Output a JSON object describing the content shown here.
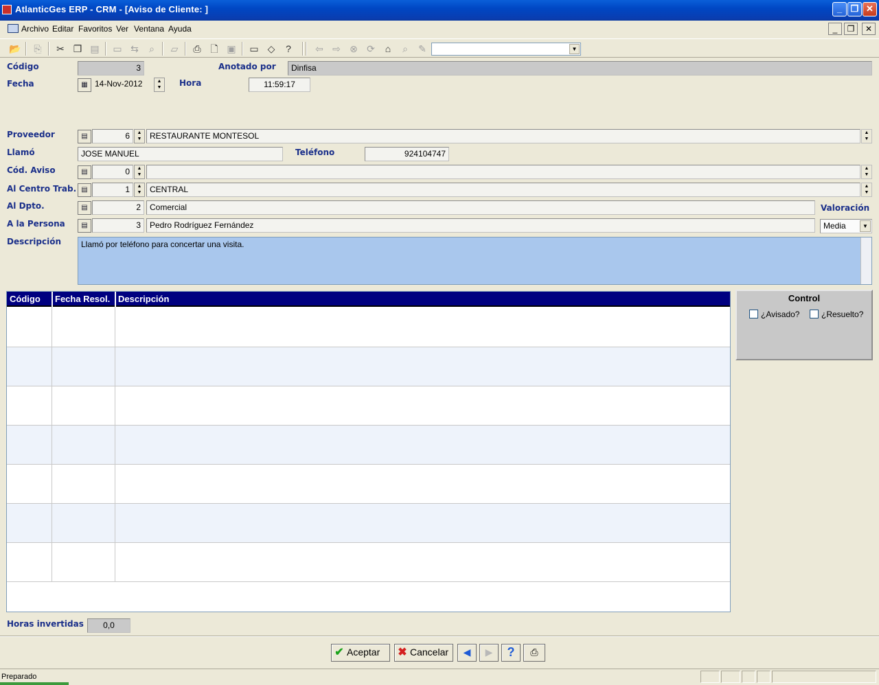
{
  "window": {
    "title": "AtlanticGes ERP - CRM - [Aviso de Cliente: ]",
    "minimize": "_",
    "restore": "❐",
    "close": "✕"
  },
  "menu": {
    "items": [
      "Archivo",
      "Editar",
      "Favoritos",
      "Ver",
      "Ventana",
      "Ayuda"
    ],
    "mdi_minimize": "_",
    "mdi_restore": "❐",
    "mdi_close": "✕"
  },
  "toolbar": {
    "combo_value": "",
    "combo_arrow": "▼",
    "icons": [
      "open-folder",
      "export",
      "cut",
      "copy",
      "paste",
      "window",
      "find-replace",
      "zoom",
      "eraser",
      "print",
      "print-preview",
      "save",
      "monitor",
      "eraser2",
      "help",
      "back",
      "forward",
      "stop",
      "refresh",
      "home",
      "search-web",
      "edit"
    ]
  },
  "form": {
    "codigo_label": "Código",
    "codigo_value": "3",
    "anotado_label": "Anotado por",
    "anotado_value": "Dinfisa",
    "fecha_label": "Fecha",
    "fecha_value": "14-Nov-2012",
    "hora_label": "Hora",
    "hora_value": "11:59:17",
    "proveedor_label": "Proveedor",
    "proveedor_code": "6",
    "proveedor_name": "RESTAURANTE MONTESOL",
    "llamo_label": "Llamó",
    "llamo_value": "JOSE MANUEL",
    "telefono_label": "Teléfono",
    "telefono_value": "924104747",
    "codaviso_label": "Cód. Aviso",
    "codaviso_code": "0",
    "codaviso_name": "",
    "centro_label": "Al Centro Trab.",
    "centro_code": "1",
    "centro_name": "CENTRAL",
    "dpto_label": "Al Dpto.",
    "dpto_code": "2",
    "dpto_name": "Comercial",
    "persona_label": "A la Persona",
    "persona_code": "3",
    "persona_name": "Pedro Rodríguez Fernández",
    "valoracion_label": "Valoración",
    "valoracion_value": "Media",
    "descripcion_label": "Descripción",
    "descripcion_value": "Llamó por teléfono para concertar una visita."
  },
  "grid": {
    "columns": [
      "Código",
      "Fecha Resol.",
      "Descripción"
    ],
    "rows": []
  },
  "control": {
    "title": "Control",
    "avisado_label": "¿Avisado?",
    "avisado_checked": false,
    "resuelto_label": "¿Resuelto?",
    "resuelto_checked": false
  },
  "horas": {
    "label": "Horas invertidas",
    "value": "0,0"
  },
  "buttons": {
    "aceptar": "Aceptar",
    "cancelar": "Cancelar"
  },
  "status": {
    "text": "Preparado"
  },
  "colors": {
    "label_blue": "#1a2f8a",
    "grid_header": "#000080",
    "description_bg": "#a9c7ed"
  }
}
